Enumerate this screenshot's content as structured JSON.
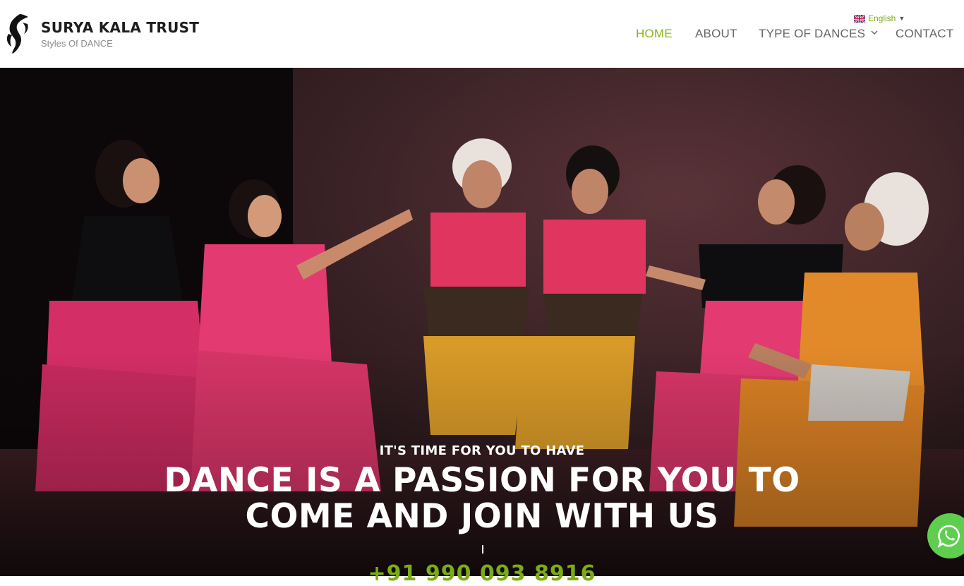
{
  "brand": {
    "title": "SURYA KALA TRUST",
    "tagline": "Styles Of DANCE"
  },
  "language": {
    "label": "English",
    "icon": "uk-flag-icon"
  },
  "nav": [
    {
      "label": "HOME",
      "active": true
    },
    {
      "label": "ABOUT",
      "active": false
    },
    {
      "label": "TYPE OF DANCES",
      "active": false,
      "icon": "chevron-down-icon"
    },
    {
      "label": "CONTACT",
      "active": false
    }
  ],
  "hero": {
    "eyebrow": "IT'S TIME FOR YOU TO HAVE",
    "headline_line1": "DANCE IS A PASSION FOR YOU TO",
    "headline_line2": "COME AND JOIN WITH US",
    "phone": "+91 990 093 8916"
  },
  "colors": {
    "accent": "#86b715",
    "nav_text": "#666666",
    "whatsapp": "#5fce4f"
  },
  "icons": {
    "logo": "dancer-logo-icon",
    "whatsapp": "whatsapp-icon"
  }
}
